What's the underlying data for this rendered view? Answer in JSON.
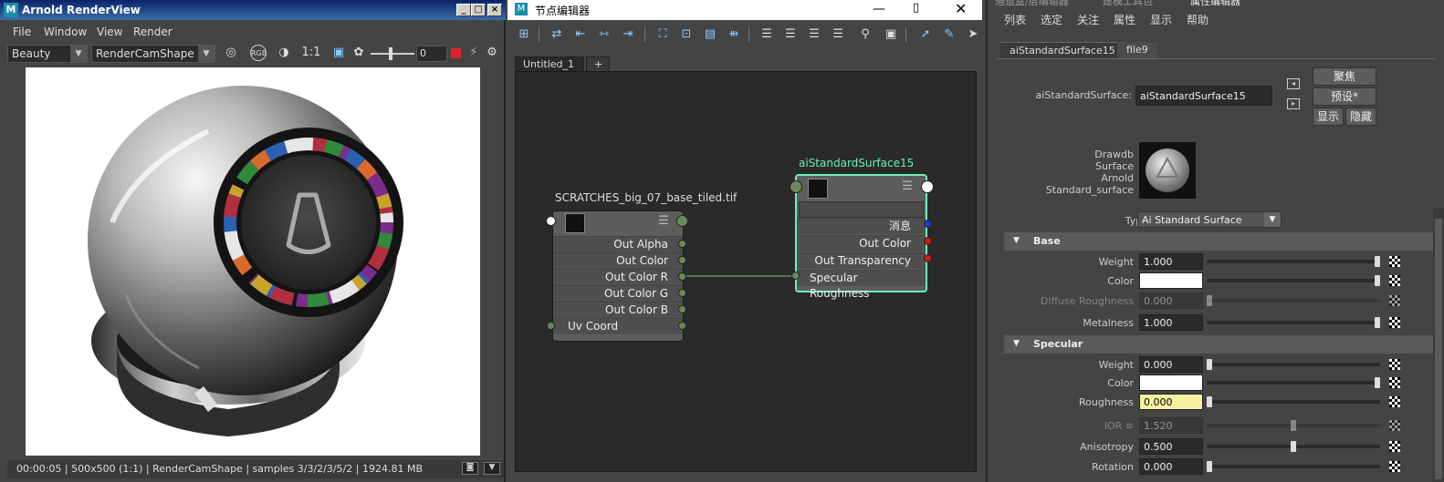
{
  "renderview": {
    "logo": "M",
    "title": "Arnold RenderView",
    "menu": [
      "File",
      "Window",
      "View",
      "Render"
    ],
    "aov_dropdown": "Beauty",
    "camera_dropdown": "RenderCamShape",
    "zoom_label": "1:1",
    "exposure_value": "0",
    "status": "00:00:05 | 500x500 (1:1) | RenderCamShape  | samples 3/3/2/3/5/2 | 1924.81 MB"
  },
  "node_editor": {
    "logo": "M",
    "title": "节点编辑器",
    "tabs": [
      "Untitled_1",
      "+"
    ],
    "file_node": {
      "title": "SCRATCHES_big_07_base_tiled.tif",
      "rows": [
        "Out Alpha",
        "Out Color",
        "Out Color R",
        "Out Color G",
        "Out Color B",
        "Uv Coord"
      ]
    },
    "shader_node": {
      "title": "aiStandardSurface15",
      "rows": [
        "消息",
        "Out Color",
        "Out Transparency",
        "Specular Roughness"
      ]
    }
  },
  "attribute_editor": {
    "top_tabs": [
      "通道盒/层编辑器",
      "建模工具包",
      "属性编辑器"
    ],
    "menu": [
      "列表",
      "选定",
      "关注",
      "属性",
      "显示",
      "帮助"
    ],
    "tabs": [
      "aiStandardSurface15",
      "file9"
    ],
    "node_type_label": "aiStandardSurface:",
    "node_name": "aiStandardSurface15",
    "buttons": {
      "focus": "聚焦",
      "presets": "预设*",
      "show": "显示",
      "hide": "隐藏"
    },
    "swatch_caption": [
      "Drawdb",
      "Surface",
      "Arnold",
      "Standard_surface"
    ],
    "type_label": "Type",
    "type_value": "Ai Standard Surface",
    "sections": {
      "base": "Base",
      "specular": "Specular"
    },
    "base_attrs": [
      {
        "label": "Weight",
        "value": "1.000",
        "level": 1.0
      },
      {
        "label": "Color",
        "value": "",
        "level": 1.0
      },
      {
        "label": "Diffuse Roughness",
        "value": "0.000",
        "level": 0.0
      },
      {
        "label": "Metalness",
        "value": "1.000",
        "level": 1.0
      }
    ],
    "specular_attrs": [
      {
        "label": "Weight",
        "value": "0.000",
        "level": 0.0
      },
      {
        "label": "Color",
        "value": "",
        "level": 1.0
      },
      {
        "label": "Roughness",
        "value": "0.000",
        "level": 0.0
      },
      {
        "label": "IOR ≡",
        "value": "1.520",
        "level": 0.5
      },
      {
        "label": "Anisotropy",
        "value": "0.500",
        "level": 0.5
      },
      {
        "label": "Rotation",
        "value": "0.000",
        "level": 0.0
      }
    ]
  }
}
